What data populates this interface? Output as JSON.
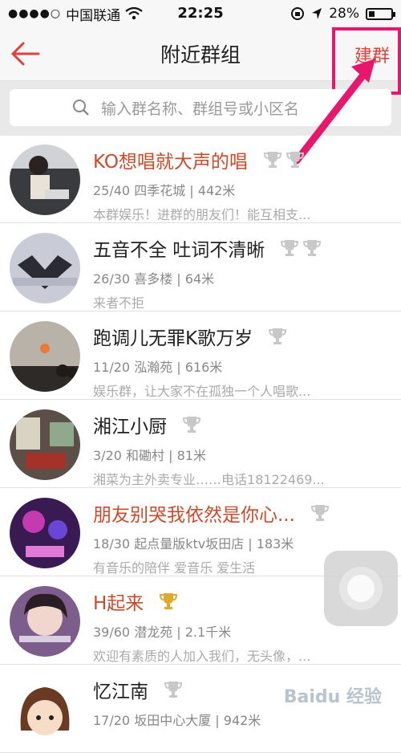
{
  "status_bar": {
    "signal": "●●●●○",
    "carrier": "中国联通",
    "time": "22:25",
    "battery": "28%"
  },
  "nav": {
    "title": "附近群组",
    "create_label": "建群"
  },
  "search": {
    "placeholder": "输入群名称、群组号或小区名"
  },
  "groups": [
    {
      "name": "KO想唱就大声的唱",
      "meta": "25/40 四季花城 | 442米",
      "desc": "本群娱乐！进群的朋友们！能互相支...",
      "name_color": "red",
      "trophies": 2
    },
    {
      "name": "五音不全 吐词不清晰",
      "meta": "26/30 喜多楼 | 64米",
      "desc": "来者不拒",
      "name_color": "black",
      "trophies": 2
    },
    {
      "name": "跑调儿无罪K歌万岁",
      "meta": "11/20 泓瀚苑 | 616米",
      "desc": "娱乐群，让大家不在孤独一个人唱歌...",
      "name_color": "black",
      "trophies": 1
    },
    {
      "name": "湘江小厨",
      "meta": "3/20 和磡村 | 81米",
      "desc": "湘菜为主外卖专业……电话18122469...",
      "name_color": "black",
      "trophies": 1
    },
    {
      "name": "朋友别哭我依然是你心...",
      "meta": "18/30 起点量版ktv坂田店 | 183米",
      "desc": "有音乐的陪伴 爱音乐 爱生活",
      "name_color": "red",
      "trophies": 1
    },
    {
      "name": "H起来",
      "meta": "39/60 潜龙苑 | 2.1千米",
      "desc": "欢迎有素质的人加入我们，无头像，...",
      "name_color": "red",
      "trophies": 1,
      "gold": true
    },
    {
      "name": "忆江南",
      "meta": "17/20 坂田中心大厦 | 942米",
      "desc": "",
      "name_color": "black",
      "trophies": 1
    }
  ],
  "watermark": "Baidu 经验",
  "colors": {
    "accent": "#e0413c",
    "highlight": "#e8176e"
  }
}
